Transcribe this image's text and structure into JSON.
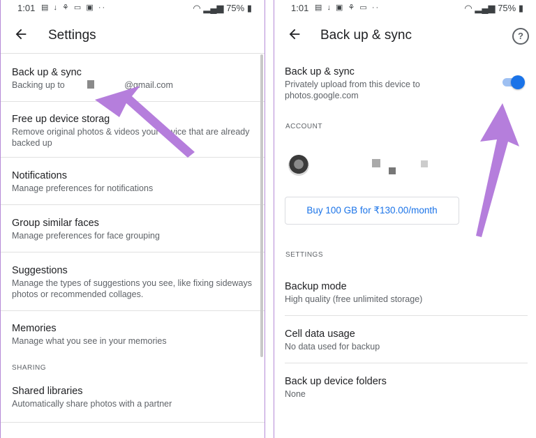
{
  "left": {
    "status": {
      "time": "1:01",
      "battery": "75%"
    },
    "title": "Settings",
    "items": [
      {
        "title": "Back up & sync",
        "subtitle_prefix": "Backing up to",
        "subtitle_suffix": "@gmail.com"
      },
      {
        "title": "Free up device storag",
        "subtitle": "Remove original photos & videos      your device that are already backed up"
      },
      {
        "title": "Notifications",
        "subtitle": "Manage preferences for notifications"
      },
      {
        "title": "Group similar faces",
        "subtitle": "Manage preferences for face grouping"
      },
      {
        "title": "Suggestions",
        "subtitle": "Manage the types of suggestions you see, like fixing sideways photos or recommended collages."
      },
      {
        "title": "Memories",
        "subtitle": "Manage what you see in your memories"
      }
    ],
    "section_sharing": "SHARING",
    "shared": {
      "title": "Shared libraries",
      "subtitle": "Automatically share photos with a partner"
    }
  },
  "right": {
    "status": {
      "time": "1:01",
      "battery": "75%"
    },
    "title": "Back up & sync",
    "help_glyph": "?",
    "backup": {
      "title": "Back up & sync",
      "subtitle": "Privately upload from this device to photos.google.com",
      "enabled": true
    },
    "section_account": "ACCOUNT",
    "buy_label": "Buy 100 GB for ₹130.00/month",
    "section_settings": "SETTINGS",
    "items": [
      {
        "title": "Backup mode",
        "subtitle": "High quality (free unlimited storage)"
      },
      {
        "title": "Cell data usage",
        "subtitle": "No data used for backup"
      },
      {
        "title": "Back up device folders",
        "subtitle": "None"
      }
    ]
  },
  "colors": {
    "accent": "#1a73e8",
    "annotation_arrow": "#b57edc",
    "frame": "#b58ad6"
  },
  "icons": [
    "arrow-left-icon",
    "help-circle-icon",
    "wifi-icon",
    "signal-icon",
    "battery-icon"
  ]
}
